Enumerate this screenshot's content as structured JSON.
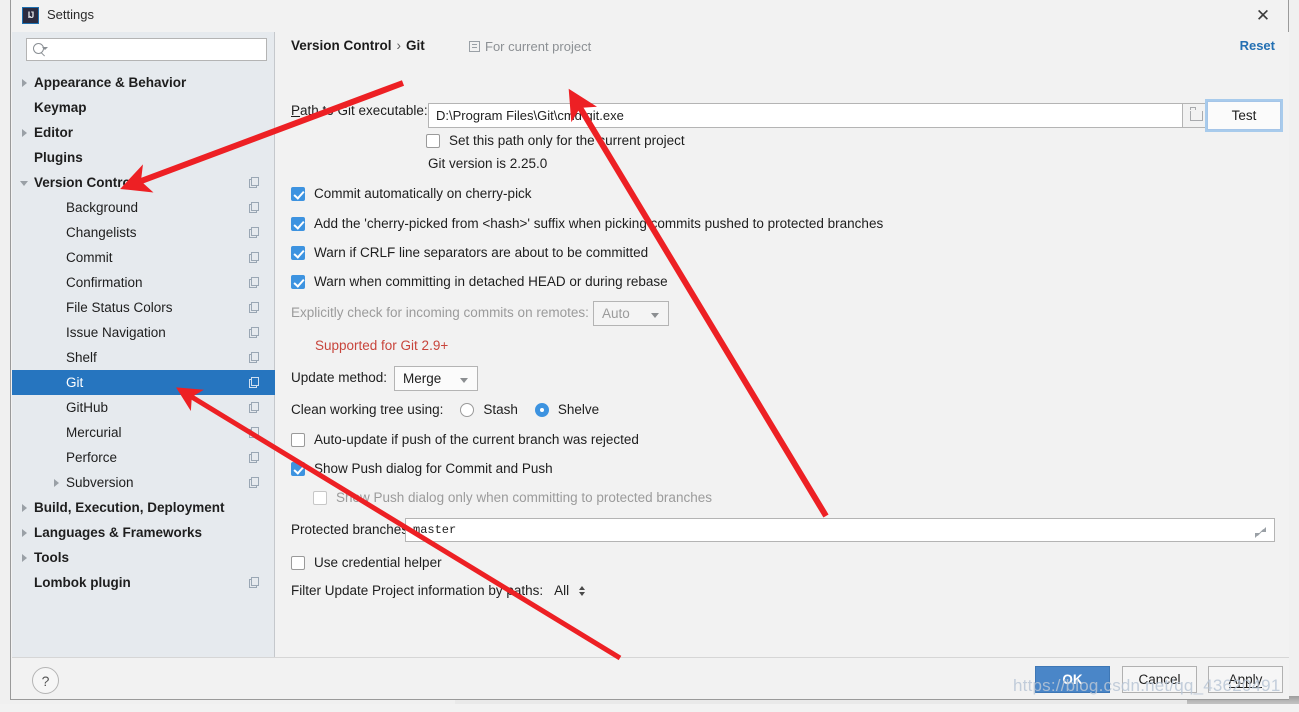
{
  "window": {
    "title": "Settings",
    "app_icon": "intellij-idea-icon",
    "close_label": "✕"
  },
  "sidebar": {
    "search": {
      "placeholder": "",
      "value": "",
      "icon": "search-icon"
    },
    "items": [
      {
        "label": "Appearance & Behavior",
        "level": 0,
        "bold": true,
        "arrow": "right",
        "copy": false,
        "selected": false
      },
      {
        "label": "Keymap",
        "level": 0,
        "bold": true,
        "arrow": "none",
        "copy": false,
        "selected": false
      },
      {
        "label": "Editor",
        "level": 0,
        "bold": true,
        "arrow": "right",
        "copy": false,
        "selected": false
      },
      {
        "label": "Plugins",
        "level": 0,
        "bold": true,
        "arrow": "none",
        "copy": false,
        "selected": false
      },
      {
        "label": "Version Control",
        "level": 0,
        "bold": true,
        "arrow": "down",
        "copy": true,
        "selected": false
      },
      {
        "label": "Background",
        "level": 1,
        "bold": false,
        "arrow": "none",
        "copy": true,
        "selected": false
      },
      {
        "label": "Changelists",
        "level": 1,
        "bold": false,
        "arrow": "none",
        "copy": true,
        "selected": false
      },
      {
        "label": "Commit",
        "level": 1,
        "bold": false,
        "arrow": "none",
        "copy": true,
        "selected": false
      },
      {
        "label": "Confirmation",
        "level": 1,
        "bold": false,
        "arrow": "none",
        "copy": true,
        "selected": false
      },
      {
        "label": "File Status Colors",
        "level": 1,
        "bold": false,
        "arrow": "none",
        "copy": true,
        "selected": false
      },
      {
        "label": "Issue Navigation",
        "level": 1,
        "bold": false,
        "arrow": "none",
        "copy": true,
        "selected": false
      },
      {
        "label": "Shelf",
        "level": 1,
        "bold": false,
        "arrow": "none",
        "copy": true,
        "selected": false
      },
      {
        "label": "Git",
        "level": 1,
        "bold": false,
        "arrow": "none",
        "copy": true,
        "selected": true
      },
      {
        "label": "GitHub",
        "level": 1,
        "bold": false,
        "arrow": "none",
        "copy": true,
        "selected": false
      },
      {
        "label": "Mercurial",
        "level": 1,
        "bold": false,
        "arrow": "none",
        "copy": true,
        "selected": false
      },
      {
        "label": "Perforce",
        "level": 1,
        "bold": false,
        "arrow": "none",
        "copy": true,
        "selected": false
      },
      {
        "label": "Subversion",
        "level": 1,
        "bold": false,
        "arrow": "right",
        "copy": true,
        "selected": false
      },
      {
        "label": "Build, Execution, Deployment",
        "level": 0,
        "bold": true,
        "arrow": "right",
        "copy": false,
        "selected": false
      },
      {
        "label": "Languages & Frameworks",
        "level": 0,
        "bold": true,
        "arrow": "right",
        "copy": false,
        "selected": false
      },
      {
        "label": "Tools",
        "level": 0,
        "bold": true,
        "arrow": "right",
        "copy": false,
        "selected": false
      },
      {
        "label": "Lombok plugin",
        "level": 0,
        "bold": true,
        "arrow": "none",
        "copy": true,
        "selected": false
      }
    ]
  },
  "main": {
    "breadcrumb": {
      "root": "Version Control",
      "separator": "›",
      "leaf": "Git"
    },
    "for_current_project": {
      "label": "For current project",
      "icon": "project-scope-icon"
    },
    "reset_label": "Reset",
    "path_row": {
      "label": "Path to Git executable:",
      "value": "D:\\Program Files\\Git\\cmd\\git.exe",
      "browse_icon": "folder-icon",
      "test_label": "Test"
    },
    "set_path_only": {
      "label": "Set this path only for the current project",
      "checked": false
    },
    "git_version": "Git version is 2.25.0",
    "checkboxes": [
      {
        "label": "Commit automatically on cherry-pick",
        "checked": true,
        "disabled": false
      },
      {
        "label": "Add the 'cherry-picked from <hash>' suffix when picking commits pushed to protected branches",
        "checked": true,
        "disabled": false
      },
      {
        "label": "Warn if CRLF line separators are about to be committed",
        "checked": true,
        "disabled": false
      },
      {
        "label": "Warn when committing in detached HEAD or during rebase",
        "checked": true,
        "disabled": false
      }
    ],
    "incoming_commits": {
      "label": "Explicitly check for incoming commits on remotes:",
      "value": "Auto",
      "disabled": true,
      "note": "Supported for Git 2.9+"
    },
    "update_method": {
      "label": "Update method:",
      "value": "Merge"
    },
    "clean_working_tree": {
      "label": "Clean working tree using:",
      "options": [
        {
          "label": "Stash",
          "selected": false
        },
        {
          "label": "Shelve",
          "selected": true
        }
      ]
    },
    "auto_update": {
      "label": "Auto-update if push of the current branch was rejected",
      "checked": false
    },
    "show_push_dialog": {
      "label": "Show Push dialog for Commit and Push",
      "checked": true
    },
    "show_push_protected": {
      "label": "Show Push dialog only when committing to protected branches",
      "checked": false,
      "disabled": true
    },
    "protected_branches": {
      "label": "Protected branches:",
      "value": "master",
      "expand_icon": "expand-icon"
    },
    "use_credential_helper": {
      "label": "Use credential helper",
      "checked": false
    },
    "filter_update": {
      "label": "Filter Update Project information by paths:",
      "value": "All",
      "spinner_icon": "spinner-icon"
    }
  },
  "footer": {
    "help_label": "?",
    "ok_label": "OK",
    "cancel_label": "Cancel",
    "apply_label": "Apply"
  },
  "watermark": "https://blog.csdn.net/qq_43620491",
  "colors": {
    "accent": "#2675bf",
    "link": "#2470b3",
    "checkbox_on": "#3d93e0",
    "warning_text": "#c8453c",
    "annotation_arrow": "#ed2024"
  }
}
